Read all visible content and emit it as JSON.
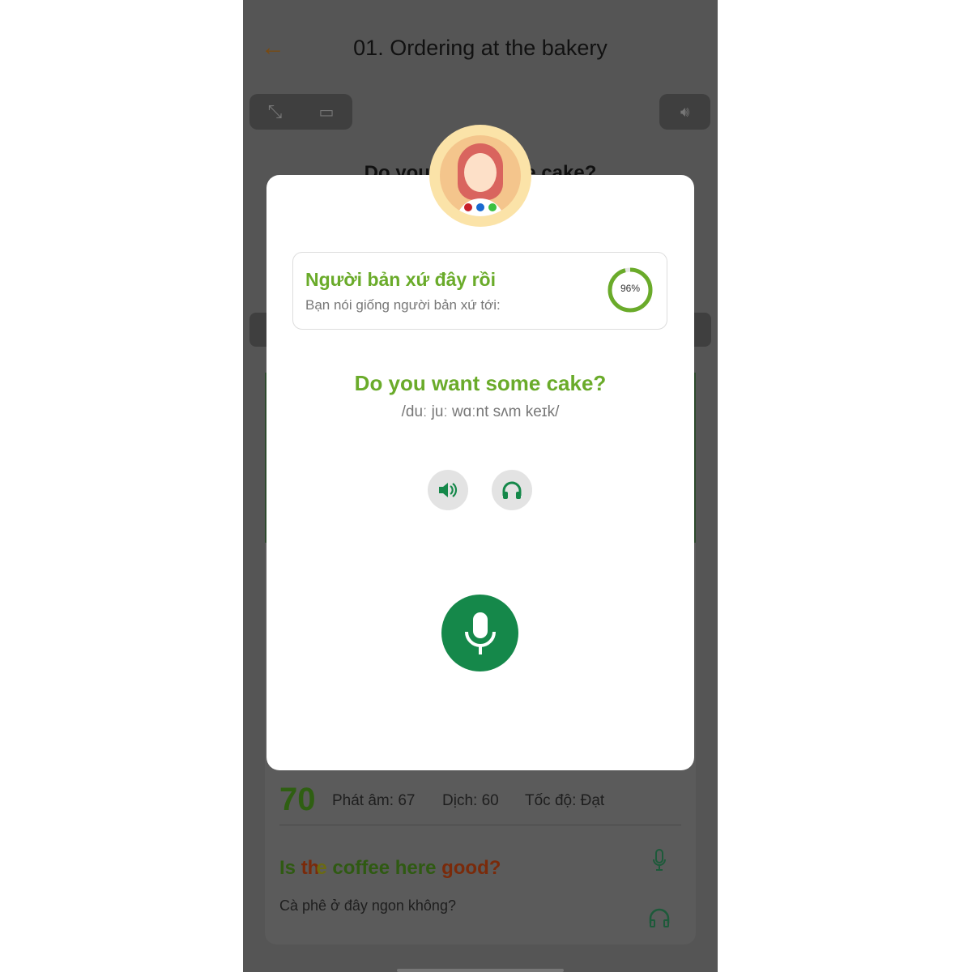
{
  "header": {
    "title": "01. Ordering at the bakery",
    "back_icon": "arrow-left-icon"
  },
  "toolbar": {
    "icons": [
      "expand-icon",
      "screen-share-icon",
      "speaker-icon"
    ]
  },
  "behind": {
    "question": "Do you want some cake?",
    "score": "70",
    "pronunciation": "Phát âm: 67",
    "translation_score": "Dịch: 60",
    "speed": "Tốc độ: Đạt",
    "sentence_words": [
      {
        "text": "Is",
        "color": "#2f5a12"
      },
      {
        "text": "th",
        "color": "#7a2a0a"
      },
      {
        "text": "e",
        "color": "#6b6a12"
      },
      {
        "text": "coffee",
        "color": "#2f5a12"
      },
      {
        "text": "here",
        "color": "#2f5a12"
      },
      {
        "text": "good?",
        "color": "#7a2a0a"
      }
    ],
    "sentence_translation": "Cà phê ở đây ngon không?"
  },
  "modal": {
    "native_title": "Người bản xứ đây rồi",
    "native_subtitle": "Bạn nói giống người bản xứ tới:",
    "similarity_percent": 96,
    "similarity_label": "96%",
    "phrase": "Do you want some cake?",
    "ipa": "/duː juː wɑːnt sʌm keɪk/"
  },
  "colors": {
    "accent_green": "#6aab2a",
    "mic_green": "#15884a"
  }
}
